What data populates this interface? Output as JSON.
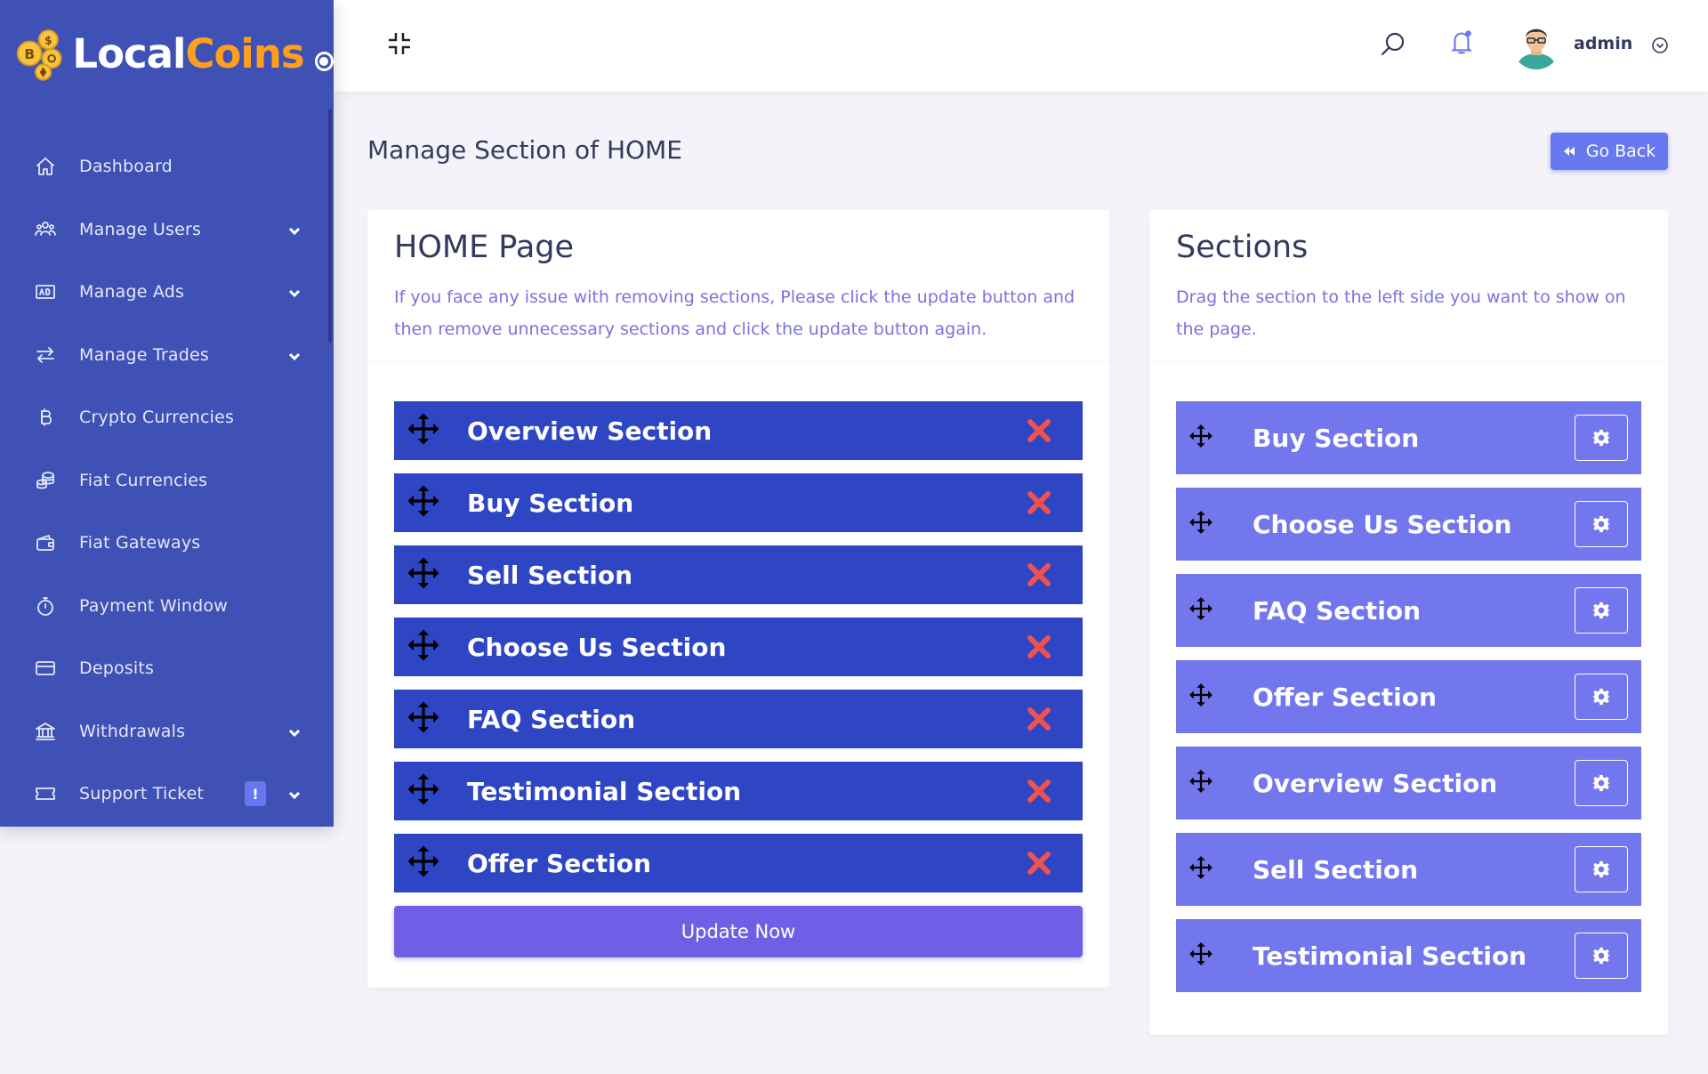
{
  "brand": {
    "local": "Local",
    "coins": "Coins"
  },
  "sidebar": {
    "items": [
      {
        "label": "Dashboard",
        "icon": "home-icon",
        "has_chevron": false
      },
      {
        "label": "Manage Users",
        "icon": "users-icon",
        "has_chevron": true
      },
      {
        "label": "Manage Ads",
        "icon": "ad-icon",
        "has_chevron": true
      },
      {
        "label": "Manage Trades",
        "icon": "exchange-icon",
        "has_chevron": true
      },
      {
        "label": "Crypto Currencies",
        "icon": "bitcoin-icon",
        "has_chevron": false
      },
      {
        "label": "Fiat Currencies",
        "icon": "coins-icon",
        "has_chevron": false
      },
      {
        "label": "Fiat Gateways",
        "icon": "wallet-icon",
        "has_chevron": false
      },
      {
        "label": "Payment Window",
        "icon": "stopwatch-icon",
        "has_chevron": false
      },
      {
        "label": "Deposits",
        "icon": "credit-card-icon",
        "has_chevron": false
      },
      {
        "label": "Withdrawals",
        "icon": "bank-icon",
        "has_chevron": true
      },
      {
        "label": "Support Ticket",
        "icon": "ticket-icon",
        "has_chevron": true,
        "badge": "!"
      }
    ]
  },
  "topbar": {
    "user_name": "admin"
  },
  "page": {
    "title": "Manage Section of HOME",
    "go_back_label": "Go Back"
  },
  "left_card": {
    "title": "HOME Page",
    "description": "If you face any issue with removing sections, Please click the update button and then remove unnecessary sections and click the update button again.",
    "sections": [
      "Overview Section",
      "Buy Section",
      "Sell Section",
      "Choose Us Section",
      "FAQ Section",
      "Testimonial Section",
      "Offer Section"
    ],
    "update_label": "Update Now"
  },
  "right_card": {
    "title": "Sections",
    "description": "Drag the section to the left side you want to show on the page.",
    "sections": [
      "Buy Section",
      "Choose Us Section",
      "FAQ Section",
      "Offer Section",
      "Overview Section",
      "Sell Section",
      "Testimonial Section"
    ]
  },
  "colors": {
    "sidebar_bg": "#3f51b5",
    "accent": "#6777ef",
    "left_row_bg": "#2e45c4",
    "right_row_bg": "#7377ee",
    "remove_icon": "#f2514f",
    "brand_coins": "#ff9f1c"
  }
}
